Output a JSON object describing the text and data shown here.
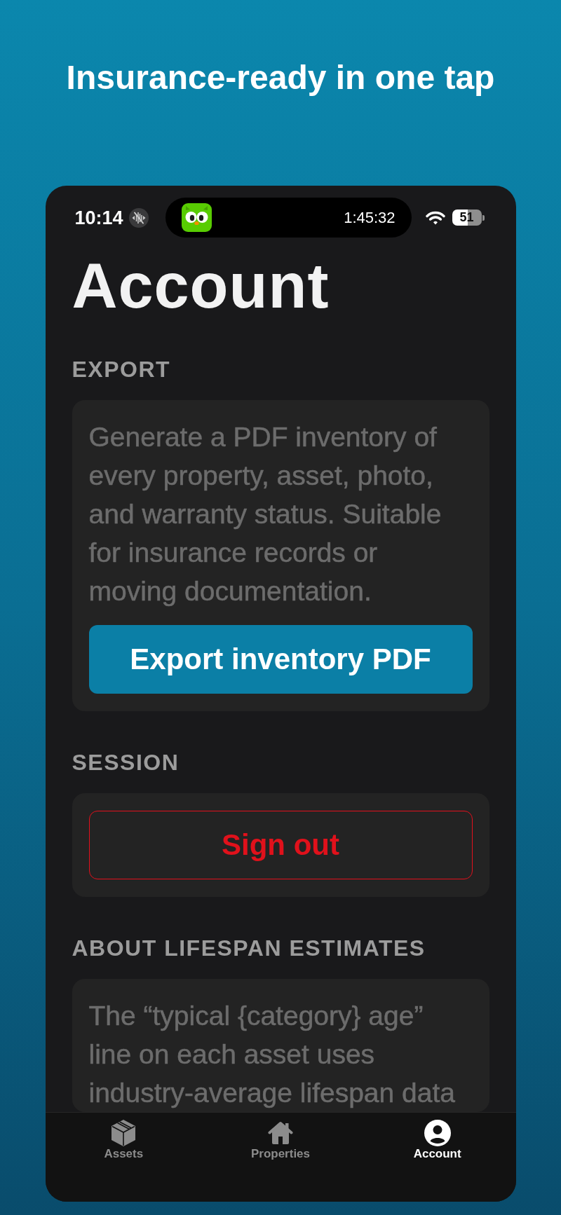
{
  "headline": "Insurance-ready in one tap",
  "status_bar": {
    "time": "10:14",
    "activity_timer": "1:45:32",
    "battery": "51"
  },
  "title": "Account",
  "sections": [
    {
      "heading": "EXPORT",
      "body": "Generate a PDF inventory of every property, asset, photo, and warranty status. Suitable for insurance records or moving documentation.",
      "button": {
        "kind": "primary",
        "label": "Export inventory PDF"
      }
    },
    {
      "heading": "SESSION",
      "button": {
        "kind": "destructive",
        "label": "Sign out"
      }
    },
    {
      "heading": "ABOUT LIFESPAN ESTIMATES",
      "body": "The “typical {category} age” line on each asset uses industry-average lifespan data"
    }
  ],
  "tab_bar": [
    {
      "label": "Assets",
      "selected": false
    },
    {
      "label": "Properties",
      "selected": false
    },
    {
      "label": "Account",
      "selected": true
    }
  ]
}
